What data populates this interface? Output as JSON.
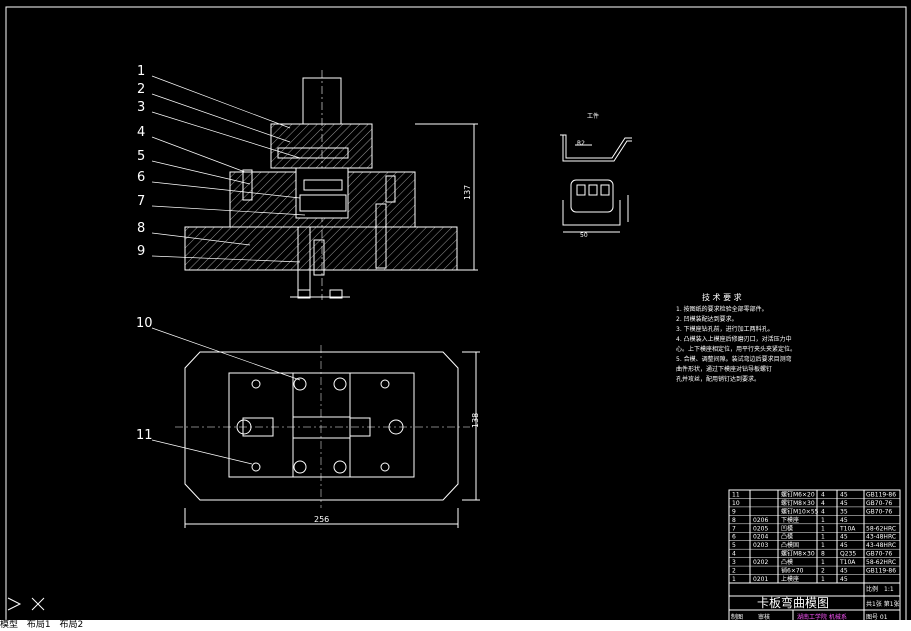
{
  "canvas_bg": "#000000",
  "line_color": "#ffffff",
  "part_labels": [
    "1",
    "2",
    "3",
    "4",
    "5",
    "6",
    "7",
    "8",
    "9",
    "10",
    "11"
  ],
  "dimensions": {
    "height_137": "137",
    "width_256": "256",
    "height_138": "138",
    "r2": "R2",
    "w50": "50"
  },
  "workpiece_label": "工件",
  "tech_req": {
    "title": "技 术 要 求",
    "lines": [
      "1. 按图纸的要求检验全部零部件。",
      "2. 凹模装配达到要求。",
      "3. 下模座钻孔前，进行加工两料孔。",
      "4. 凸模装入上模座后修磨刃口，对活压力中",
      "   心。上下模座相定位，用平行夹头夹紧定位。",
      "5. 合模、调整间隙。装试弯边后要求目测弯",
      "   曲件形状，通过下模座对钻导板螺钉",
      "   孔并攻丝，配用销钉达到要求。"
    ]
  },
  "bom": [
    {
      "no": "11",
      "code": "",
      "name": "螺钉M6×20",
      "qty": "4",
      "mat": "45",
      "std": "GB119-86"
    },
    {
      "no": "10",
      "code": "",
      "name": "螺钉M8×30",
      "qty": "4",
      "mat": "45",
      "std": "GB70-76"
    },
    {
      "no": "9",
      "code": "",
      "name": "螺钉M10×55",
      "qty": "4",
      "mat": "35",
      "std": "GB70-76"
    },
    {
      "no": "8",
      "code": "0206",
      "name": "下模座",
      "qty": "1",
      "mat": "45",
      "std": ""
    },
    {
      "no": "7",
      "code": "0205",
      "name": "凹模",
      "qty": "1",
      "mat": "T10A",
      "std": "58-62HRC"
    },
    {
      "no": "6",
      "code": "0204",
      "name": "凸模",
      "qty": "1",
      "mat": "45",
      "std": "43-48HRC"
    },
    {
      "no": "5",
      "code": "0203",
      "name": "凸模固",
      "qty": "1",
      "mat": "45",
      "std": "43-48HRC"
    },
    {
      "no": "4",
      "code": "",
      "name": "螺钉M8×30",
      "qty": "8",
      "mat": "Q235",
      "std": "GB70-76"
    },
    {
      "no": "3",
      "code": "0202",
      "name": "凸模",
      "qty": "1",
      "mat": "T10A",
      "std": "58-62HRC"
    },
    {
      "no": "2",
      "code": "",
      "name": "销6×70",
      "qty": "2",
      "mat": "45",
      "std": "GB119-86"
    },
    {
      "no": "1",
      "code": "0201",
      "name": "上模座",
      "qty": "1",
      "mat": "45",
      "std": ""
    }
  ],
  "title_block": {
    "title": "卡板弯曲模图",
    "scale_label": "比例",
    "scale": "1:1",
    "sheet": "共1张 第1张",
    "drawn": "制图",
    "checked": "审核",
    "school": "湖南工学院 机械系",
    "drawing_no": "图号 01"
  },
  "command": {
    "prompt": "",
    "tabs": [
      "模型",
      "布局1",
      "布局2"
    ]
  }
}
